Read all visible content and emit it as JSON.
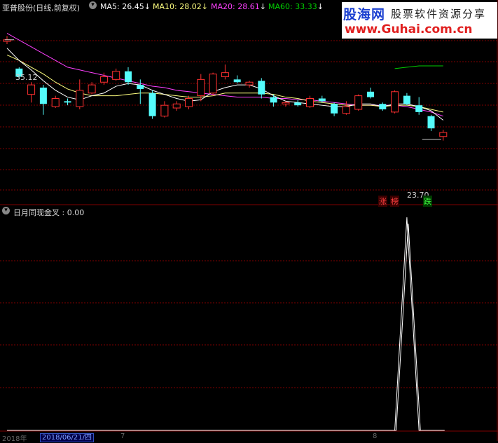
{
  "header": {
    "title": "亚普股份(日线,前复权)",
    "ma5_label": "MA5:",
    "ma5_value": "26.45",
    "ma10_label": "MA10:",
    "ma10_value": "28.02",
    "ma20_label": "MA20:",
    "ma20_value": "28.61",
    "ma60_label": "MA60:",
    "ma60_value": "33.33",
    "down_arrow": "↓"
  },
  "watermark": {
    "brand": "股海网",
    "slogan": "股票软件资源分享",
    "url": "www.Guhai.com.cn"
  },
  "indicator": {
    "title": "日月同现金叉",
    "value_text": ": 0.00"
  },
  "annotations": {
    "high_label": "35.12",
    "low_label": "23.70",
    "limit_up_tag_1": "涨",
    "limit_up_tag_2": "榜",
    "limit_down_tag": "跌"
  },
  "footer": {
    "left_text": "2018年",
    "date_box": "2018/06/21/四",
    "mark_7": "7",
    "mark_8": "8"
  },
  "colors": {
    "background": "#000000",
    "grid": "#800000",
    "up": "#ff3030",
    "down": "#54fcfc",
    "ma5": "#ffffff",
    "ma10": "#ffff80",
    "ma20": "#ff40ff",
    "ma60": "#00d000",
    "signal": "#ffffff"
  },
  "chart_data": [
    {
      "type": "candlestick",
      "title": "亚普股份(日线,前复权)",
      "candles": [
        {
          "o": 35.0,
          "h": 35.4,
          "l": 34.8,
          "c": 35.12
        },
        {
          "o": 33.0,
          "h": 33.1,
          "l": 32.2,
          "c": 32.4
        },
        {
          "o": 31.1,
          "h": 32.0,
          "l": 30.5,
          "c": 31.8
        },
        {
          "o": 31.6,
          "h": 31.8,
          "l": 29.6,
          "c": 30.4
        },
        {
          "o": 30.2,
          "h": 31.0,
          "l": 30.1,
          "c": 30.8
        },
        {
          "o": 30.6,
          "h": 30.8,
          "l": 30.3,
          "c": 30.5
        },
        {
          "o": 30.2,
          "h": 32.2,
          "l": 30.0,
          "c": 31.4
        },
        {
          "o": 31.2,
          "h": 32.0,
          "l": 31.1,
          "c": 31.8
        },
        {
          "o": 32.0,
          "h": 32.7,
          "l": 31.8,
          "c": 32.4
        },
        {
          "o": 32.2,
          "h": 33.0,
          "l": 32.1,
          "c": 32.8
        },
        {
          "o": 32.8,
          "h": 33.1,
          "l": 31.8,
          "c": 32.0
        },
        {
          "o": 31.8,
          "h": 32.2,
          "l": 30.4,
          "c": 31.5
        },
        {
          "o": 31.2,
          "h": 31.4,
          "l": 29.3,
          "c": 29.5
        },
        {
          "o": 29.5,
          "h": 30.6,
          "l": 29.4,
          "c": 30.3
        },
        {
          "o": 30.1,
          "h": 30.6,
          "l": 29.9,
          "c": 30.4
        },
        {
          "o": 30.2,
          "h": 31.0,
          "l": 30.0,
          "c": 30.8
        },
        {
          "o": 31.0,
          "h": 32.6,
          "l": 30.6,
          "c": 32.2
        },
        {
          "o": 31.2,
          "h": 32.7,
          "l": 31.0,
          "c": 32.6
        },
        {
          "o": 32.4,
          "h": 33.3,
          "l": 32.2,
          "c": 32.7
        },
        {
          "o": 32.2,
          "h": 32.5,
          "l": 31.9,
          "c": 32.0
        },
        {
          "o": 31.8,
          "h": 32.1,
          "l": 31.6,
          "c": 32.0
        },
        {
          "o": 32.1,
          "h": 32.3,
          "l": 30.8,
          "c": 31.1
        },
        {
          "o": 30.9,
          "h": 31.1,
          "l": 30.2,
          "c": 30.5
        },
        {
          "o": 30.4,
          "h": 30.6,
          "l": 30.2,
          "c": 30.5
        },
        {
          "o": 30.5,
          "h": 30.7,
          "l": 30.2,
          "c": 30.3
        },
        {
          "o": 30.2,
          "h": 31.0,
          "l": 30.1,
          "c": 30.8
        },
        {
          "o": 30.8,
          "h": 31.0,
          "l": 30.5,
          "c": 30.6
        },
        {
          "o": 30.4,
          "h": 30.5,
          "l": 29.5,
          "c": 29.7
        },
        {
          "o": 29.7,
          "h": 30.6,
          "l": 29.6,
          "c": 30.2
        },
        {
          "o": 30.0,
          "h": 31.1,
          "l": 29.9,
          "c": 31.0
        },
        {
          "o": 31.3,
          "h": 31.6,
          "l": 30.8,
          "c": 30.9
        },
        {
          "o": 30.4,
          "h": 30.5,
          "l": 29.9,
          "c": 30.0
        },
        {
          "o": 29.8,
          "h": 31.4,
          "l": 29.7,
          "c": 31.3
        },
        {
          "o": 31.0,
          "h": 31.2,
          "l": 30.3,
          "c": 30.4
        },
        {
          "o": 30.3,
          "h": 30.9,
          "l": 29.6,
          "c": 29.8
        },
        {
          "o": 29.5,
          "h": 29.6,
          "l": 28.4,
          "c": 28.6
        },
        {
          "o": 28.0,
          "h": 28.5,
          "l": 27.7,
          "c": 28.3
        }
      ],
      "ma5": [
        34.5,
        33.6,
        32.9,
        32.1,
        31.4,
        30.9,
        30.7,
        31.0,
        31.2,
        31.7,
        31.9,
        31.8,
        31.4,
        31.1,
        30.8,
        30.6,
        30.7,
        31.3,
        31.6,
        31.8,
        31.8,
        31.5,
        31.0,
        30.6,
        30.5,
        30.4,
        30.3,
        30.2,
        30.2,
        30.4,
        30.4,
        30.2,
        30.4,
        30.4,
        30.2,
        29.9,
        29.2
      ],
      "ma10": [
        34.0,
        33.6,
        33.1,
        32.6,
        32.0,
        31.5,
        31.2,
        31.0,
        31.0,
        31.0,
        31.1,
        31.2,
        31.2,
        31.1,
        31.0,
        30.9,
        30.9,
        31.0,
        31.2,
        31.2,
        31.2,
        31.2,
        31.1,
        30.9,
        30.8,
        30.6,
        30.5,
        30.4,
        30.3,
        30.3,
        30.3,
        30.2,
        30.3,
        30.3,
        30.2,
        30.0,
        29.8
      ],
      "ma20": [
        35.6,
        35.1,
        34.6,
        34.1,
        33.6,
        33.1,
        32.9,
        32.7,
        32.5,
        32.3,
        32.1,
        31.9,
        31.7,
        31.6,
        31.4,
        31.3,
        31.2,
        31.1,
        31.0,
        30.9,
        30.9,
        30.9,
        30.8,
        30.8,
        30.7,
        30.7,
        30.6,
        30.5,
        30.4,
        30.3,
        30.3,
        30.3,
        30.3,
        30.2,
        30.0,
        29.8,
        29.5
      ],
      "ma60": [
        null,
        null,
        null,
        null,
        null,
        null,
        null,
        null,
        null,
        null,
        null,
        null,
        null,
        null,
        null,
        null,
        null,
        null,
        null,
        null,
        null,
        null,
        null,
        null,
        null,
        null,
        null,
        null,
        null,
        null,
        null,
        null,
        33.0,
        33.1,
        33.2,
        33.2,
        33.2
      ],
      "max_label": "35.12",
      "min_label": "23.70"
    },
    {
      "type": "line",
      "title": "日月同现金叉",
      "series": [
        {
          "name": "日月同现金叉",
          "values": [
            0,
            0,
            0,
            0,
            0,
            0,
            0,
            0,
            0,
            0,
            0,
            0,
            0,
            0,
            0,
            0,
            0,
            0,
            0,
            0,
            0,
            0,
            0,
            0,
            0,
            0,
            0,
            0,
            0,
            0,
            0,
            0,
            0,
            1,
            0,
            0,
            0
          ]
        }
      ]
    }
  ]
}
